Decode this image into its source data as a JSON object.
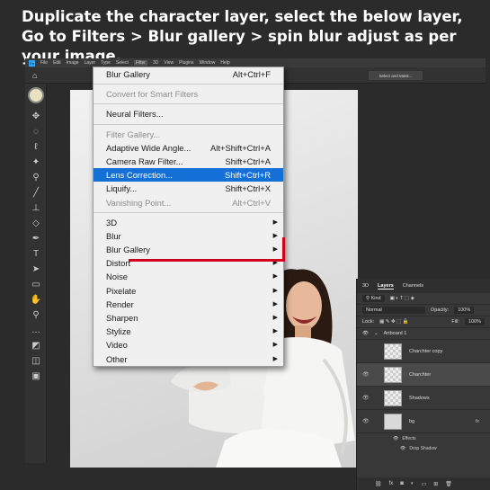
{
  "headline": "Duplicate the character layer, select the below layer, Go to Filters > Blur gallery > spin blur adjust as per your image.",
  "menubar": {
    "logo": "Ps",
    "items": [
      "File",
      "Edit",
      "Image",
      "Layer",
      "Type",
      "Select",
      "Filter",
      "3D",
      "View",
      "Plugins",
      "Window",
      "Help"
    ],
    "active_item": "Filter"
  },
  "options_bar": {
    "select_mask_label": "Select and Mask..."
  },
  "filter_menu": {
    "items": [
      {
        "label": "Blur Gallery",
        "shortcut": "Alt+Ctrl+F",
        "state": "normal"
      },
      {
        "sep": true
      },
      {
        "label": "Convert for Smart Filters",
        "shortcut": "",
        "state": "disabled"
      },
      {
        "sep": true
      },
      {
        "label": "Neural Filters...",
        "shortcut": "",
        "state": "normal"
      },
      {
        "sep": true
      },
      {
        "label": "Filter Gallery...",
        "shortcut": "",
        "state": "disabled"
      },
      {
        "label": "Adaptive Wide Angle...",
        "shortcut": "Alt+Shift+Ctrl+A",
        "state": "normal"
      },
      {
        "label": "Camera Raw Filter...",
        "shortcut": "Shift+Ctrl+A",
        "state": "normal"
      },
      {
        "label": "Lens Correction...",
        "shortcut": "Shift+Ctrl+R",
        "state": "highlighted"
      },
      {
        "label": "Liquify...",
        "shortcut": "Shift+Ctrl+X",
        "state": "normal"
      },
      {
        "label": "Vanishing Point...",
        "shortcut": "Alt+Ctrl+V",
        "state": "disabled"
      },
      {
        "sep": true
      },
      {
        "label": "3D",
        "submenu": true,
        "state": "normal"
      },
      {
        "label": "Blur",
        "submenu": true,
        "state": "normal"
      },
      {
        "label": "Blur Gallery",
        "submenu": true,
        "state": "normal"
      },
      {
        "label": "Distort",
        "submenu": true,
        "state": "normal"
      },
      {
        "label": "Noise",
        "submenu": true,
        "state": "normal"
      },
      {
        "label": "Pixelate",
        "submenu": true,
        "state": "normal"
      },
      {
        "label": "Render",
        "submenu": true,
        "state": "normal"
      },
      {
        "label": "Sharpen",
        "submenu": true,
        "state": "normal"
      },
      {
        "label": "Stylize",
        "submenu": true,
        "state": "normal"
      },
      {
        "label": "Video",
        "submenu": true,
        "state": "normal"
      },
      {
        "label": "Other",
        "submenu": true,
        "state": "normal"
      }
    ]
  },
  "layers_panel": {
    "tabs": [
      "3D",
      "Layers",
      "Channels"
    ],
    "active_tab": "Layers",
    "kind_label": "Kind",
    "blend_mode": "Normal",
    "opacity_label": "Opacity:",
    "opacity_value": "100%",
    "lock_label": "Lock:",
    "fill_label": "Fill:",
    "fill_value": "100%",
    "artboard_name": "Artboard 1",
    "layers": [
      {
        "name": "Charchter copy",
        "selected": false,
        "visible": false
      },
      {
        "name": "Charchter",
        "selected": true,
        "visible": true
      },
      {
        "name": "Shadows",
        "selected": false,
        "visible": true
      },
      {
        "name": "bg",
        "selected": false,
        "visible": true,
        "fx": true
      }
    ],
    "effects_label": "Effects",
    "drop_shadow_label": "Drop Shadow"
  },
  "colors": {
    "highlight": "#1470d6",
    "annotation_red": "#d0001f",
    "ui_dark": "#323232"
  }
}
